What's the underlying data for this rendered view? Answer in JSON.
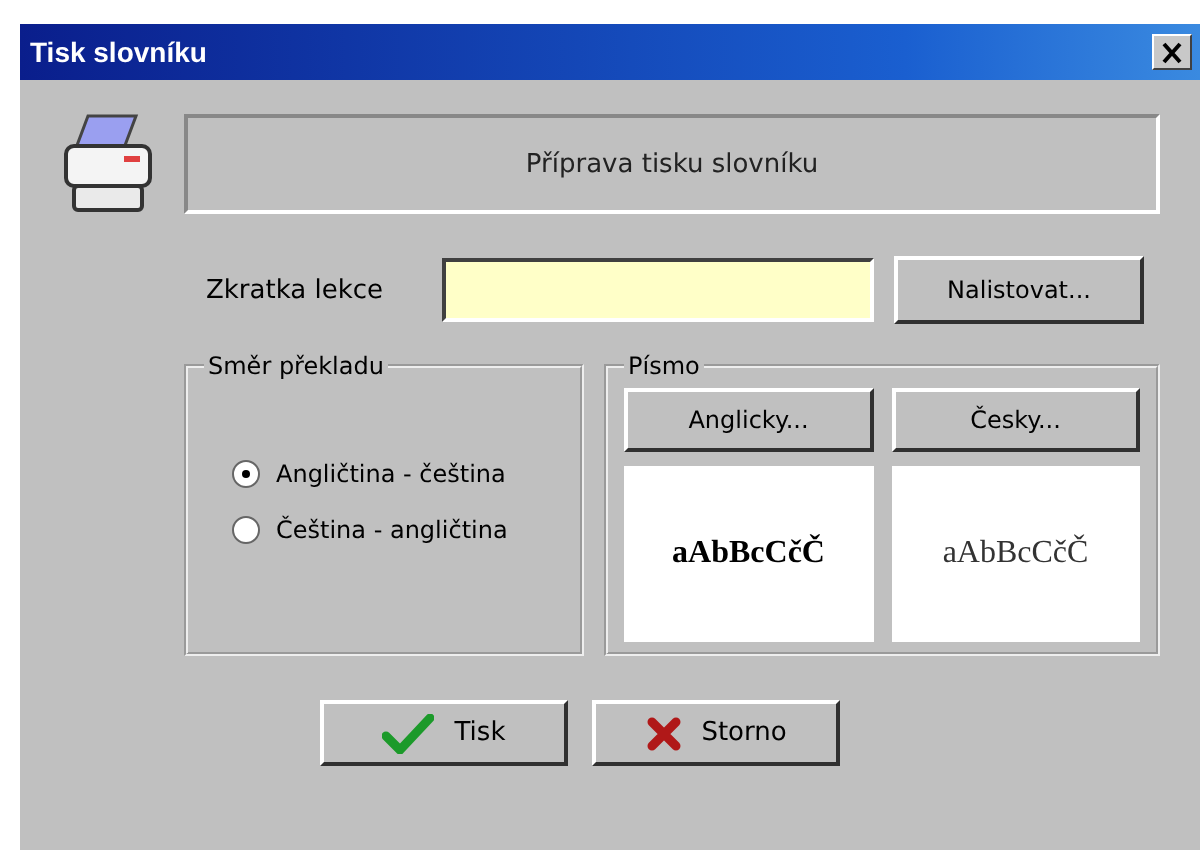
{
  "window": {
    "title": "Tisk slovníku"
  },
  "header": "Příprava tisku slovníku",
  "lesson_field": {
    "label": "Zkratka lekce"
  },
  "browse_button": "Nalistovat...",
  "direction": {
    "title": "Směr překladu",
    "options": [
      {
        "label": "Angličtina - čeština",
        "selected": true
      },
      {
        "label": "Čeština - angličtina",
        "selected": false
      }
    ]
  },
  "font": {
    "title": "Písmo",
    "columns": [
      {
        "button": "Anglicky...",
        "sample": "aAbBcCčČ",
        "bold": true
      },
      {
        "button": "Česky...",
        "sample": "aAbBcCčČ",
        "bold": false
      }
    ]
  },
  "buttons": [
    {
      "label": "Tisk",
      "kind": "ok"
    },
    {
      "label": "Storno",
      "kind": "cancel"
    }
  ]
}
